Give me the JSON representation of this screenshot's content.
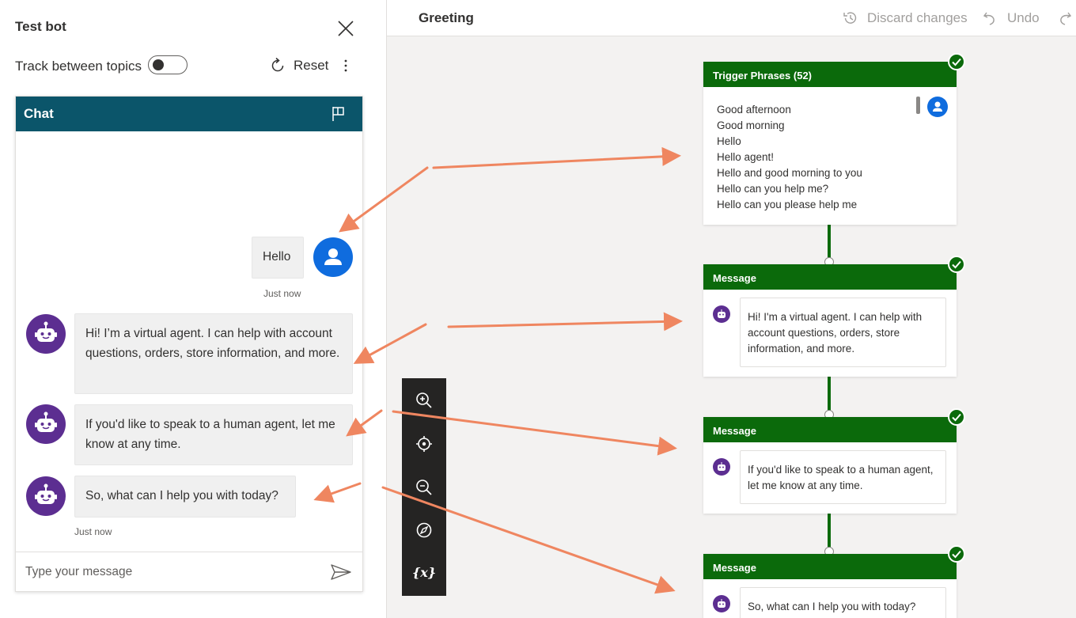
{
  "test_pane": {
    "title": "Test bot",
    "track_label": "Track between topics",
    "reset_label": "Reset",
    "chat": {
      "header": "Chat",
      "messages": [
        {
          "role": "user",
          "text": "Hello",
          "time": "Just now"
        },
        {
          "role": "bot",
          "text": "Hi! I’m a virtual agent. I can help with account questions, orders, store information, and more."
        },
        {
          "role": "bot",
          "text": "If you'd like to speak to a human agent, let me know at any time."
        },
        {
          "role": "bot",
          "text": "So, what can I help you with today?",
          "time": "Just now"
        }
      ],
      "input_placeholder": "Type your message"
    }
  },
  "canvas": {
    "topic_name": "Greeting",
    "actions": {
      "discard": "Discard changes",
      "undo": "Undo"
    },
    "trigger": {
      "header": "Trigger Phrases (52)",
      "phrases": [
        "Good afternoon",
        "Good morning",
        "Hello",
        "Hello agent!",
        "Hello and good morning to you",
        "Hello can you help me?",
        "Hello can you please help me"
      ]
    },
    "messages": [
      {
        "header": "Message",
        "text": "Hi! I'm a virtual agent. I can help with account questions, orders, store information, and more."
      },
      {
        "header": "Message",
        "text": "If you'd like to speak to a human agent, let me know at any time."
      },
      {
        "header": "Message",
        "text": "So, what can I help you with today?"
      }
    ],
    "zoom_controls": [
      "zoom-in",
      "recenter",
      "zoom-out",
      "compass",
      "variables"
    ],
    "variables_label": "{x}"
  },
  "colors": {
    "chat_header": "#0b556a",
    "node_header": "#0b6a0b",
    "user_avatar": "#0f6cde",
    "bot_avatar": "#5c2e91",
    "annotation_arrow": "#ef8660"
  }
}
